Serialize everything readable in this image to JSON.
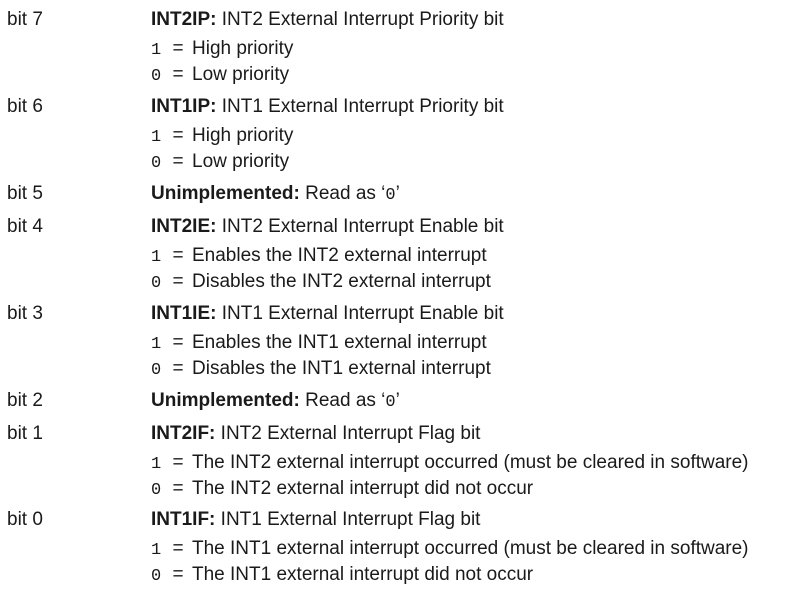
{
  "rows": [
    {
      "bit": "bit 7",
      "name": "INT2IP:",
      "text": "INT2 External Interrupt Priority bit",
      "values": [
        {
          "code": "1",
          "text": "High priority"
        },
        {
          "code": "0",
          "text": "Low priority"
        }
      ]
    },
    {
      "bit": "bit 6",
      "name": "INT1IP:",
      "text": "INT1 External Interrupt Priority bit",
      "values": [
        {
          "code": "1",
          "text": "High priority"
        },
        {
          "code": "0",
          "text": "Low priority"
        }
      ]
    },
    {
      "bit": "bit 5",
      "name": "Unimplemented:",
      "text": "Read as ‘",
      "code": "0",
      "text_end": "’"
    },
    {
      "bit": "bit 4",
      "name": "INT2IE:",
      "text": "INT2 External Interrupt Enable bit",
      "values": [
        {
          "code": "1",
          "text": "Enables the INT2 external interrupt"
        },
        {
          "code": "0",
          "text": "Disables the INT2 external interrupt"
        }
      ]
    },
    {
      "bit": "bit 3",
      "name": "INT1IE:",
      "text": "INT1 External Interrupt Enable bit",
      "values": [
        {
          "code": "1",
          "text": "Enables the INT1 external interrupt"
        },
        {
          "code": "0",
          "text": "Disables the INT1 external interrupt"
        }
      ]
    },
    {
      "bit": "bit 2",
      "name": "Unimplemented:",
      "text": "Read as ‘",
      "code": "0",
      "text_end": "’"
    },
    {
      "bit": "bit 1",
      "name": "INT2IF:",
      "text": "INT2 External Interrupt Flag bit",
      "values": [
        {
          "code": "1",
          "text": "The INT2 external interrupt occurred (must be cleared in software)"
        },
        {
          "code": "0",
          "text": "The INT2 external interrupt did not occur"
        }
      ]
    },
    {
      "bit": "bit 0",
      "name": "INT1IF:",
      "text": "INT1 External Interrupt Flag bit",
      "values": [
        {
          "code": "1",
          "text": "The INT1 external interrupt occurred (must be cleared in software)"
        },
        {
          "code": "0",
          "text": "The INT1 external interrupt did not occur"
        }
      ]
    }
  ],
  "eq_symbol": "="
}
